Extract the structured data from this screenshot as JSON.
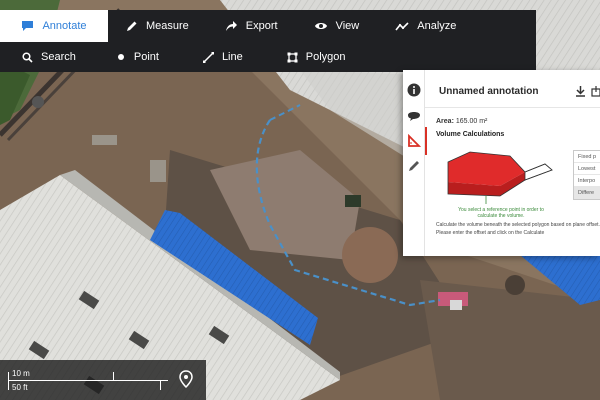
{
  "toolbar": {
    "tabs": [
      {
        "label": "Annotate",
        "icon": "chat-bubble-icon",
        "active": true
      },
      {
        "label": "Measure",
        "icon": "pencil-icon"
      },
      {
        "label": "Export",
        "icon": "share-arrow-icon"
      },
      {
        "label": "View",
        "icon": "eye-icon"
      },
      {
        "label": "Analyze",
        "icon": "line-chart-icon"
      }
    ],
    "tools": [
      {
        "label": "Search",
        "icon": "search-icon"
      },
      {
        "label": "Point",
        "icon": "dot-icon"
      },
      {
        "label": "Line",
        "icon": "line-icon"
      },
      {
        "label": "Polygon",
        "icon": "polygon-icon"
      }
    ]
  },
  "panel": {
    "title": "Unnamed annotation",
    "area_label": "Area:",
    "area_value": "165.00 m²",
    "volume_title": "Volume Calculations",
    "graphic_caption": "You select a reference point in order to calculate the volume.",
    "description": "Calculate the volume beneath the selected polygon based on plane offset. Please enter the offset and click on the Calculate",
    "methods": [
      "Fixed p",
      "Lowest",
      "Interpo",
      "Differe"
    ],
    "selected_method_index": 3,
    "rail_icons": [
      "info-icon",
      "comment-icon",
      "ruler-triangle-icon",
      "pen-icon"
    ]
  },
  "scale": {
    "metric": "10 m",
    "imperial": "50 ft"
  },
  "colors": {
    "toolbar_bg": "#1f2023",
    "accent_blue": "#2f7fd8",
    "volume_red": "#e02b2b",
    "boundary_dash": "#4a90c8"
  }
}
